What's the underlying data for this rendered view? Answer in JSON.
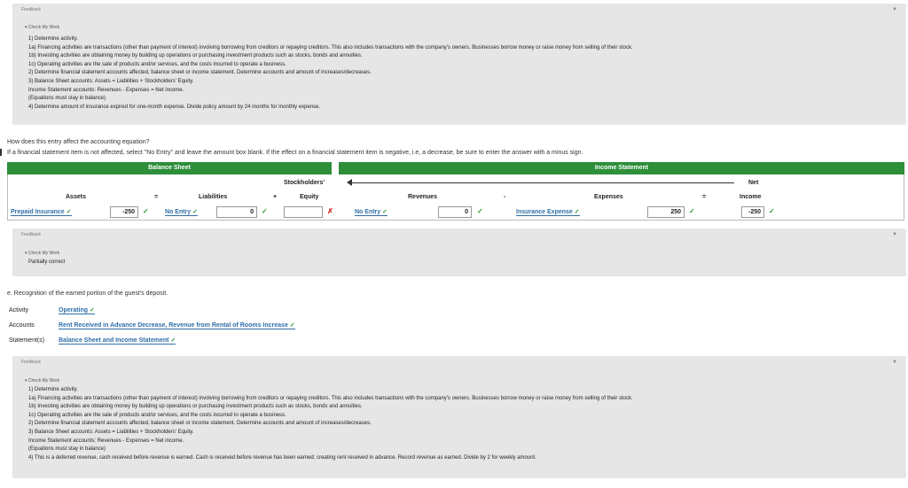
{
  "feedback1": {
    "title": "Feedback",
    "check": "▾ Check My Work",
    "lines": [
      "1) Determine activity.",
      "1a) Financing activities are transactions (other than payment of interest) involving borrowing from creditors or repaying creditors. This also includes transactions with the company's owners. Businesses borrow money or raise money from selling of their stock.",
      "1b) Investing activities are obtaining money by building up operations or purchasing investment products such as stocks, bonds and annuities.",
      "1c) Operating activities are the sale of products and/or services, and the costs incurred to operate a business.",
      "2) Determine financial statement accounts affected, balance sheet or income statement. Determine accounts and amount of increases/decreases.",
      "3) Balance Sheet accounts: Assets = Liabilities + Stockholders' Equity.",
      "Income Statement accounts: Revenues - Expenses = Net income.",
      "(Equations must stay in balance)",
      "4) Determine amount of insurance expired for one-month expense. Divide policy amount by 24 months for monthly expense."
    ]
  },
  "question": {
    "line1": "How does this entry affect the accounting equation?",
    "line2": "If a financial statement item is not affected, select \"No Entry\" and leave the amount box blank. If the effect on a financial statement item is negative, i.e, a decrease, be sure to enter the answer with a minus sign."
  },
  "table": {
    "balance_sheet": "Balance Sheet",
    "income_statement": "Income Statement",
    "col_assets": "Assets",
    "col_liabilities": "Liabilities",
    "col_stockholders": "Stockholders'",
    "col_equity": "Equity",
    "col_revenues": "Revenues",
    "col_expenses": "Expenses",
    "col_net": "Net",
    "col_income": "Income",
    "op_eq": "=",
    "op_plus": "+",
    "op_minus": "-",
    "op_eq2": "=",
    "assets_account": "Prepaid Insurance",
    "assets_amount": "-250",
    "liabilities_account": "No Entry",
    "liabilities_amount": "0",
    "equity_amount": "",
    "revenues_account": "No Entry",
    "revenues_amount": "0",
    "expenses_account": "Insurance Expense",
    "expenses_amount": "250",
    "net_income_amount": "-250",
    "check": "✓",
    "cross": "✗"
  },
  "feedback2": {
    "title": "Feedback",
    "check": "▾ Check My Work",
    "text": "Partially correct"
  },
  "partE": {
    "title": "e. Recognition of the earned portion of the guest's deposit.",
    "activity_label": "Activity",
    "activity_value": "Operating",
    "accounts_label": "Accounts",
    "accounts_value": "Rent Received in Advance Decrease, Revenue from Rental of Rooms Increase",
    "statements_label": "Statement(s)",
    "statements_value": "Balance Sheet and Income Statement"
  },
  "feedback3": {
    "title": "Feedback",
    "check": "▾ Check My Work",
    "lines": [
      "1) Determine activity.",
      "1a) Financing activities are transactions (other than payment of interest) involving borrowing from creditors or repaying creditors. This also includes transactions with the company's owners. Businesses borrow money or raise money from selling of their stock.",
      "1b) Investing activities are obtaining money by building up operations or purchasing investment products such as stocks, bonds and annuities.",
      "1c) Operating activities are the sale of products and/or services, and the costs incurred to operate a business.",
      "2) Determine financial statement accounts affected, balance sheet or income statement. Determine accounts and amount of increases/decreases.",
      "3) Balance Sheet accounts: Assets = Liabilities + Stockholders' Equity.",
      "Income Statement accounts: Revenues - Expenses = Net income.",
      "(Equations must stay in balance)",
      "4) This is a deferred revenue, cash received before revenue is earned. Cash is received before revenue has been earned; creating rent received in advance. Record revenue as earned. Divide by 2 for weekly amount."
    ]
  }
}
